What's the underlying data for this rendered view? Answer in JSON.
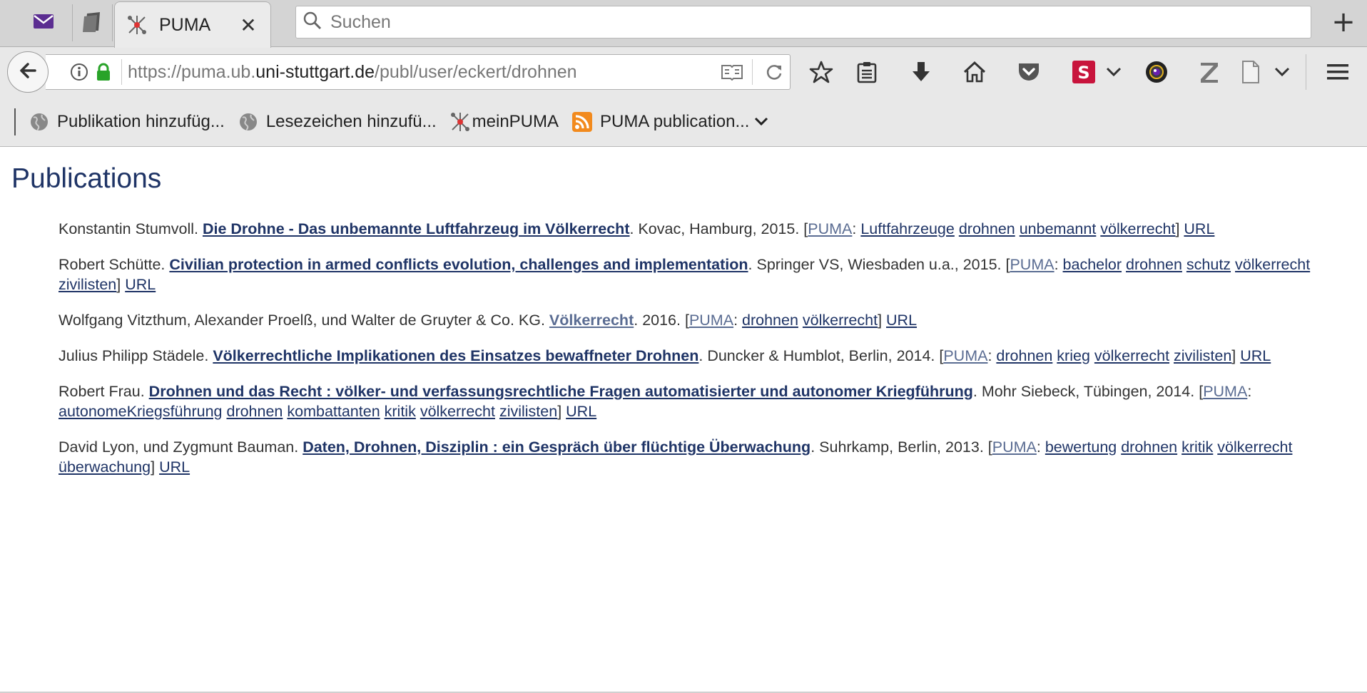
{
  "tabs": {
    "active_title": "PUMA",
    "close_glyph": "✕"
  },
  "search": {
    "placeholder": "Suchen"
  },
  "newtab_glyph": "+",
  "urlbar": {
    "prefix": "https://puma.ub.",
    "domain": "uni-stuttgart.de",
    "path": "/publ/user/eckert/drohnen"
  },
  "bookmarks": [
    {
      "label": "Publikation hinzufüg...",
      "icon": "globe-icon"
    },
    {
      "label": "Lesezeichen hinzufü...",
      "icon": "globe-icon"
    },
    {
      "label": "meinPUMA",
      "icon": "puma-icon"
    },
    {
      "label": "PUMA publication...",
      "icon": "rss-icon"
    }
  ],
  "page": {
    "title": "Publications",
    "publications": [
      {
        "authors": "Konstantin Stumvoll. ",
        "title": "Die Drohne - Das unbemannte Luftfahrzeug im Völkerrecht",
        "pub": "Kovac, Hamburg, 2015. [",
        "puma": "PUMA",
        "tags": [
          "Luftfahrzeuge",
          "drohnen",
          "unbemannt",
          "völkerrecht"
        ],
        "url": "URL"
      },
      {
        "authors": "Robert Schütte. ",
        "title": "Civilian protection in armed conflicts evolution, challenges and implementation",
        "pub": "Springer VS, Wiesbaden u.a., 2015. [",
        "puma": "PUMA",
        "tags": [
          "bachelor",
          "drohnen",
          "schutz",
          "völkerrecht",
          "zivilisten"
        ],
        "url": "URL"
      },
      {
        "authors": "Wolfgang Vitzthum, Alexander Proelß, und Walter de Gruyter & Co. KG. ",
        "title": "Völkerrecht",
        "pub": "2016. [",
        "puma": "PUMA",
        "tags": [
          "drohnen",
          "völkerrecht"
        ],
        "url": "URL",
        "visited": true
      },
      {
        "authors": "Julius Philipp Städele. ",
        "title": "Völkerrechtliche Implikationen des Einsatzes bewaffneter Drohnen",
        "pub": "Duncker & Humblot, Berlin, 2014. [",
        "puma": "PUMA",
        "tags": [
          "drohnen",
          "krieg",
          "völkerrecht",
          "zivilisten"
        ],
        "url": "URL"
      },
      {
        "authors": "Robert Frau. ",
        "title": "Drohnen und das Recht : völker- und verfassungsrechtliche Fragen automatisierter und autonomer Kriegführung",
        "pub": "Mohr Siebeck, Tübingen, 2014. [",
        "puma": "PUMA",
        "tags": [
          "autonomeKriegsführung",
          "drohnen",
          "kombattanten",
          "kritik",
          "völkerrecht",
          "zivilisten"
        ],
        "url": "URL"
      },
      {
        "authors": "David Lyon, und Zygmunt Bauman. ",
        "title": "Daten, Drohnen, Disziplin : ein Gespräch über flüchtige Überwachung",
        "pub": "Suhrkamp, Berlin, 2013. [",
        "puma": "PUMA",
        "tags": [
          "bewertung",
          "drohnen",
          "kritik",
          "völkerrecht",
          "überwachung"
        ],
        "url": "URL"
      }
    ]
  },
  "colors": {
    "link": "#1f3466",
    "visited": "#5a6c92",
    "heading": "#1f3466",
    "rss": "#f28a1d",
    "pocket": "#555555",
    "saver": "#c8143c"
  }
}
